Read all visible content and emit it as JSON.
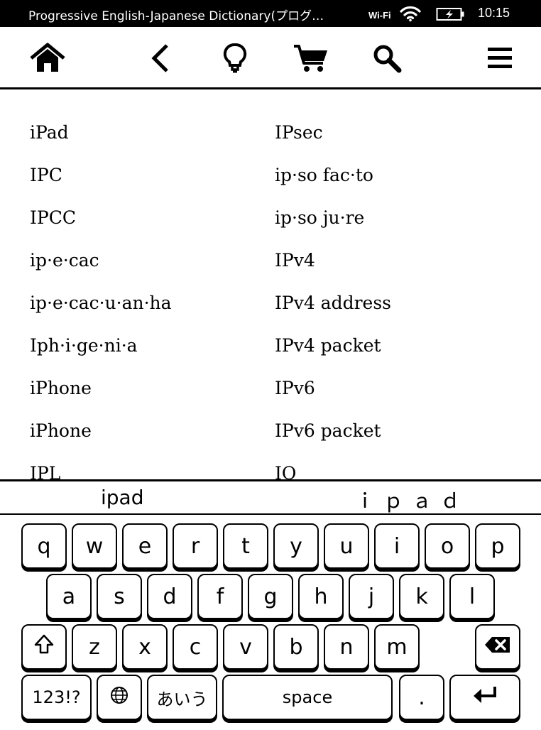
{
  "status_bar": {
    "title": "Progressive English-Japanese Dictionary(プログ…",
    "wifi_label": "Wi-Fi",
    "time": "10:15"
  },
  "toolbar": {
    "buttons": [
      "home-icon",
      "back-icon",
      "lightbulb-icon",
      "cart-icon",
      "search-icon",
      "menu-icon"
    ]
  },
  "results": {
    "left": [
      "iPad",
      "IPC",
      "IPCC",
      "ip·e·cac",
      "ip·e·cac·u·an·ha",
      "Iph·i·ge·ni·a",
      "iPhone",
      "iPhone",
      "IPL"
    ],
    "right": [
      "IPsec",
      "ip·so fac·to",
      "ip·so ju·re",
      "IPv4",
      "IPv4 address",
      "IPv4 packet",
      "IPv6",
      "IPv6 packet",
      "IQ"
    ]
  },
  "candidates": [
    "ipad",
    "ｉｐａｄ"
  ],
  "keyboard": {
    "row1": [
      "q",
      "w",
      "e",
      "r",
      "t",
      "y",
      "u",
      "i",
      "o",
      "p"
    ],
    "row2": [
      "a",
      "s",
      "d",
      "f",
      "g",
      "h",
      "j",
      "k",
      "l"
    ],
    "row3": [
      "z",
      "x",
      "c",
      "v",
      "b",
      "n",
      "m"
    ],
    "numbers_label": "123!?",
    "kana_label": "あいう",
    "space_label": "space",
    "period_label": "."
  }
}
